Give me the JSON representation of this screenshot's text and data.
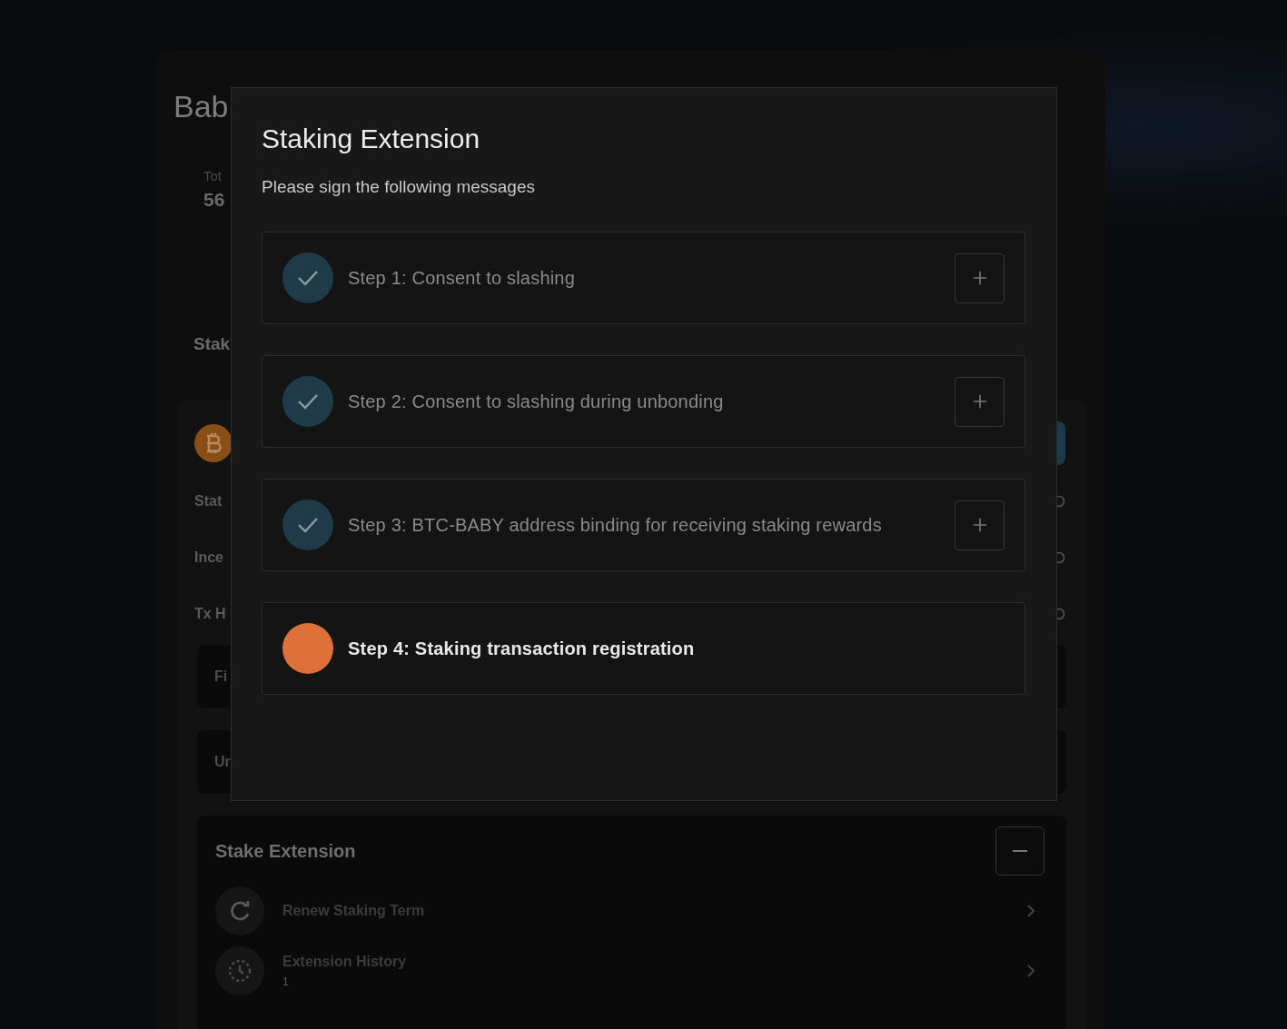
{
  "page": {
    "title": "Bab",
    "total_label": "Tot",
    "total_value": "56",
    "section_title": "Stak",
    "delegation": {
      "rows": [
        {
          "label": "Stat"
        },
        {
          "label": "Ince"
        },
        {
          "label": "Tx H"
        }
      ],
      "boxes": [
        {
          "label": "Fi"
        },
        {
          "label": "Ur"
        }
      ]
    },
    "stake_extension": {
      "title": "Stake Extension",
      "expanded": true,
      "items": [
        {
          "kind": "renew",
          "label": "Renew Staking Term"
        },
        {
          "kind": "history",
          "label": "Extension History",
          "count": "1"
        }
      ]
    }
  },
  "modal": {
    "title": "Staking Extension",
    "subtitle": "Please sign the following messages",
    "steps": [
      {
        "label": "Step 1: Consent to slashing",
        "completed": true
      },
      {
        "label": "Step 2: Consent to slashing during unbonding",
        "completed": true
      },
      {
        "label": "Step 3: BTC-BABY address binding for receiving staking rewards",
        "completed": true
      },
      {
        "label": "Step 4: Staking transaction registration",
        "completed": false
      }
    ]
  }
}
